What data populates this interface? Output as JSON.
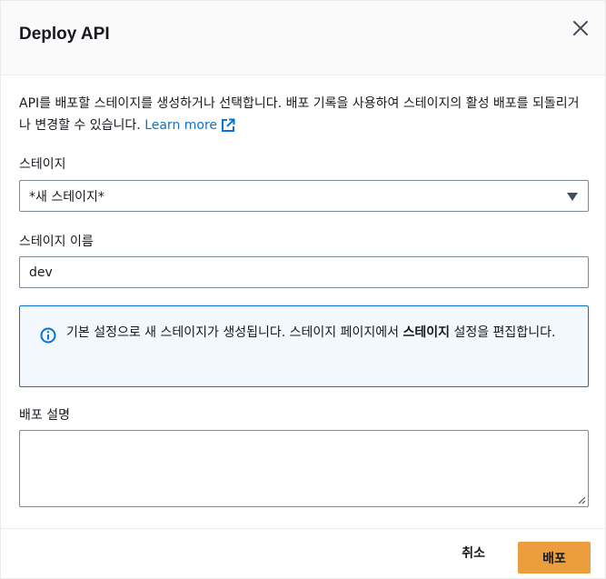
{
  "dialog": {
    "title": "Deploy API"
  },
  "description": {
    "text": "API를 배포할 스테이지를 생성하거나 선택합니다. 배포 기록을 사용하여 스테이지의 활성 배포를 되돌리거나 변경할 수 있습니다.",
    "learn_more": "Learn more"
  },
  "stage": {
    "label": "스테이지",
    "selected": "*새 스테이지*"
  },
  "stage_name": {
    "label": "스테이지 이름",
    "value": "dev"
  },
  "info_alert": {
    "text_before": "기본 설정으로 새 스테이지가 생성됩니다. 스테이지 페이지에서 ",
    "bold": "스테이지",
    "text_after": " 설정을 편집합니다."
  },
  "deployment_description": {
    "label": "배포 설명",
    "value": ""
  },
  "footer": {
    "cancel_label": "취소",
    "deploy_label": "배포"
  },
  "colors": {
    "primary_button": "#ec9d3d",
    "link": "#0972d3",
    "alert_border": "#0972d3",
    "alert_bg": "#f2f8fd"
  },
  "icons": {
    "close": "close-icon",
    "external": "external-link-icon",
    "caret": "caret-down-icon",
    "info": "info-icon",
    "resize": "resize-handle-icon"
  }
}
